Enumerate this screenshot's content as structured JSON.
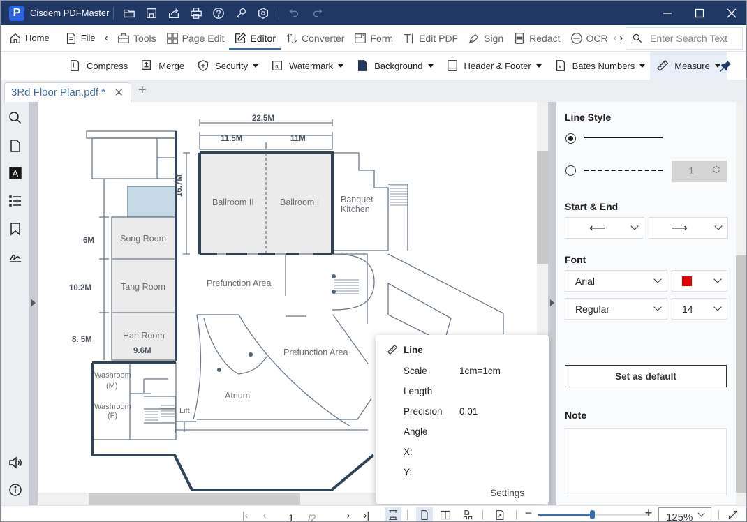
{
  "app": {
    "title": "Cisdem PDFMaster",
    "logo_letter": "P"
  },
  "titlebar_icons": [
    "open-folder-icon",
    "save-icon",
    "share-icon",
    "print-icon",
    "help-icon",
    "key-icon",
    "settings-icon",
    "undo-icon",
    "redo-icon"
  ],
  "menu": {
    "items": [
      {
        "label": "Home",
        "icon": "home-icon"
      },
      {
        "label": "File",
        "icon": "file-icon"
      },
      {
        "label": "Tools",
        "icon": "toolbox-icon"
      },
      {
        "label": "Page Edit",
        "icon": "grid-icon"
      },
      {
        "label": "Editor",
        "icon": "edit-icon",
        "active": true
      },
      {
        "label": "Converter",
        "icon": "convert-icon"
      },
      {
        "label": "Form",
        "icon": "form-icon"
      },
      {
        "label": "Edit PDF",
        "icon": "text-cursor-icon"
      },
      {
        "label": "Sign",
        "icon": "pen-icon"
      },
      {
        "label": "Redact",
        "icon": "redact-icon"
      },
      {
        "label": "OCR",
        "icon": "ocr-icon"
      }
    ],
    "search_placeholder": "Enter Search Text"
  },
  "subtoolbar": {
    "items": [
      {
        "label": "Compress",
        "dropdown": false
      },
      {
        "label": "Merge",
        "dropdown": false
      },
      {
        "label": "Security",
        "dropdown": true
      },
      {
        "label": "Watermark",
        "dropdown": true
      },
      {
        "label": "Background",
        "dropdown": true
      },
      {
        "label": "Header & Footer",
        "dropdown": true
      },
      {
        "label": "Bates Numbers",
        "dropdown": true
      },
      {
        "label": "Measure",
        "dropdown": true,
        "active": true
      }
    ]
  },
  "tabs": [
    {
      "label": "3Rd Floor Plan.pdf *",
      "active": true
    }
  ],
  "floorplan": {
    "dimensions": {
      "total_width": "22.5M",
      "left_width": "11.5M",
      "right_width": "11M",
      "height": "16.7M",
      "song_room": "6M",
      "tang_room": "10.2M",
      "han_room": "8. 5M",
      "han_width": "9.6M"
    },
    "rooms": {
      "ballroom2": "Ballroom II",
      "ballroom1": "Ballroom I",
      "banquet1": "Banquet",
      "banquet2": "Kitchen",
      "song": "Song Room",
      "tang": "Tang Room",
      "han": "Han Room",
      "prefunction1": "Prefunction Area",
      "prefunction2": "Prefunction Area",
      "atrium": "Atrium",
      "washroom_m1": "Washroom",
      "washroom_m2": "(M)",
      "washroom_f1": "Washroom",
      "washroom_f2": "(F)",
      "lift": "Lift"
    }
  },
  "measure_popup": {
    "title": "Line",
    "rows": [
      {
        "label": "Scale",
        "value": "1cm=1cm"
      },
      {
        "label": "Length",
        "value": ""
      },
      {
        "label": "Precision",
        "value": "0.01"
      },
      {
        "label": "Angle",
        "value": ""
      },
      {
        "label": "X:",
        "value": ""
      },
      {
        "label": "Y:",
        "value": ""
      }
    ],
    "settings_label": "Settings"
  },
  "right_panel": {
    "line_style_title": "Line Style",
    "line_style_selected": "solid",
    "dash_width": "1",
    "start_end_title": "Start & End",
    "start_arrow": "⟵",
    "end_arrow": "⟶",
    "font_title": "Font",
    "font_family": "Arial",
    "font_color": "#e00000",
    "font_style": "Regular",
    "font_size": "14",
    "set_default_label": "Set as default",
    "note_title": "Note",
    "note_value": ""
  },
  "statusbar": {
    "current_page": "1",
    "total_pages": "/2",
    "zoom_level": "125%",
    "zoom_fraction": 0.48
  }
}
